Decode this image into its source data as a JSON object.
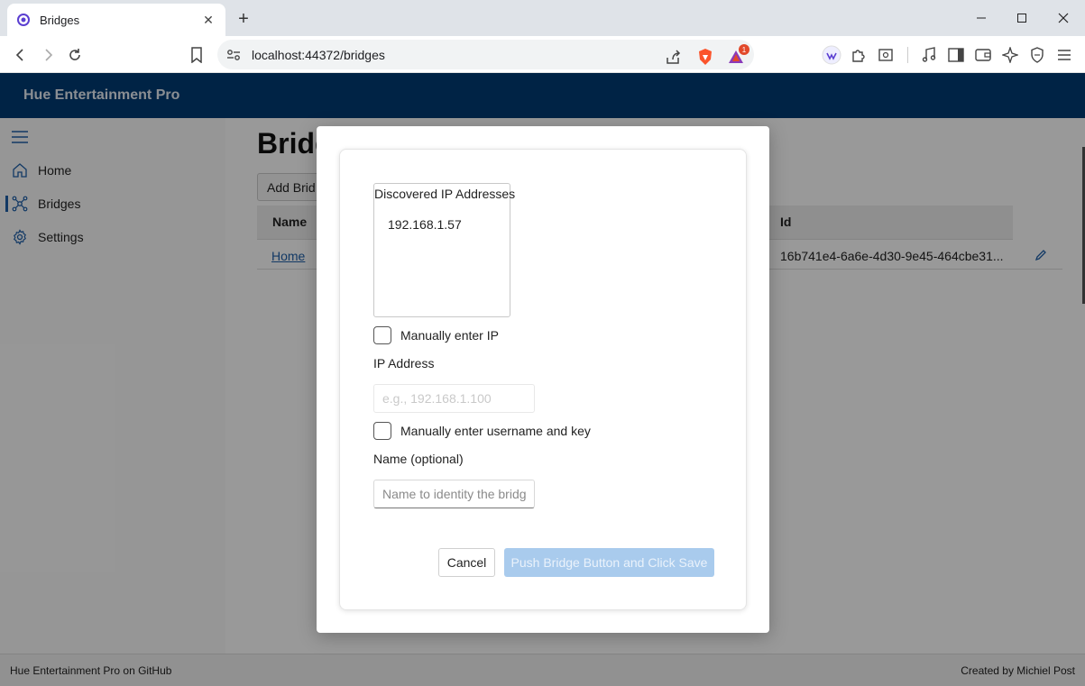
{
  "browser": {
    "tab_title": "Bridges",
    "url": "localhost:44372/bridges",
    "shield_badge": "1"
  },
  "app": {
    "brand": "Hue Entertainment Pro",
    "nav": [
      {
        "label": "Home",
        "icon": "home-icon"
      },
      {
        "label": "Bridges",
        "icon": "network-icon"
      },
      {
        "label": "Settings",
        "icon": "gear-icon"
      }
    ],
    "page_title": "Bridg",
    "add_button": "Add Brid",
    "grid": {
      "columns": [
        "Name",
        "Id"
      ],
      "rows": [
        {
          "name": "Home",
          "id": "16b741e4-6a6e-4d30-9e45-464cbe31..."
        }
      ]
    },
    "footer": {
      "left": "Hue Entertainment Pro on GitHub",
      "right": "Created by Michiel Post"
    }
  },
  "dialog": {
    "discovered_label": "Discovered IP Addresses",
    "discovered_ips": [
      "192.168.1.57"
    ],
    "manual_ip_label": "Manually enter IP",
    "manual_ip_checked": false,
    "ip_label": "IP Address",
    "ip_placeholder": "e.g., 192.168.1.100",
    "ip_value": "",
    "manual_key_label": "Manually enter username and key",
    "manual_key_checked": false,
    "name_label": "Name (optional)",
    "name_placeholder": "Name to identity the bridge",
    "name_value": "",
    "cancel_label": "Cancel",
    "save_label": "Push Bridge Button and Click Save"
  },
  "colors": {
    "header_bg": "#003b73",
    "accent": "#1f5fa8",
    "save_disabled": "#a9cbed"
  }
}
